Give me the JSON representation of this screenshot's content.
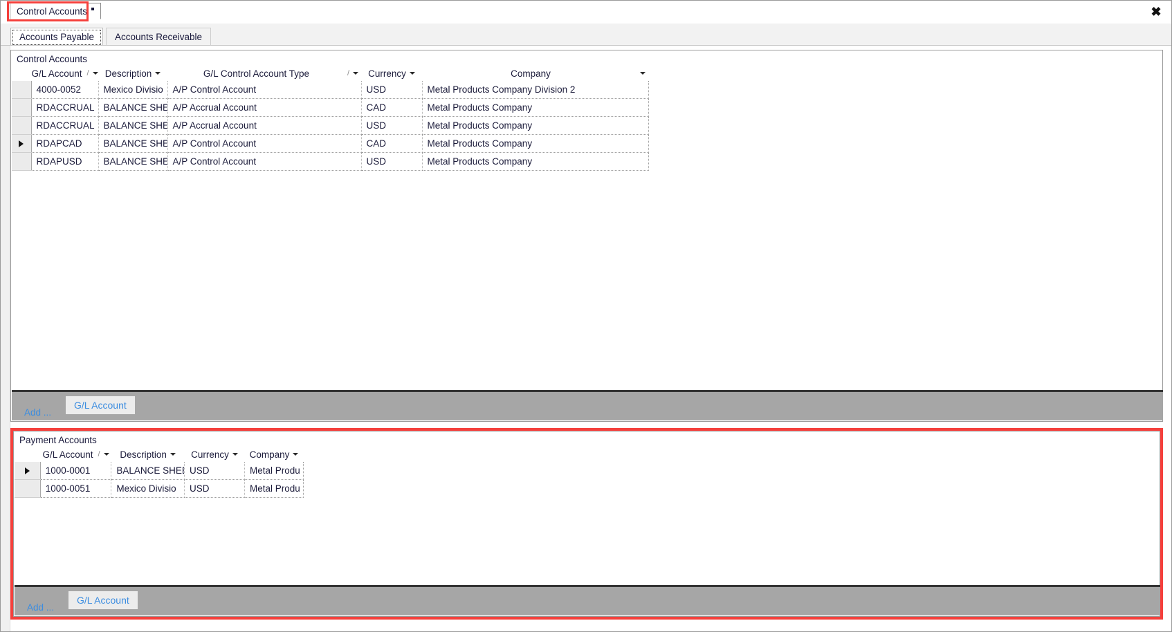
{
  "window": {
    "tab_label": "Control Accounts",
    "close_icon": "close-icon"
  },
  "tabs": [
    {
      "label": "Accounts Payable",
      "selected": true
    },
    {
      "label": "Accounts Receivable",
      "selected": false
    }
  ],
  "control_accounts": {
    "title": "Control Accounts",
    "columns": [
      {
        "label": "G/L Account",
        "sort": "/",
        "caret": true,
        "align": "center"
      },
      {
        "label": "Description",
        "sort": "",
        "caret": true,
        "align": "center"
      },
      {
        "label": "G/L Control Account Type",
        "sort": "/",
        "caret": true,
        "align": "center"
      },
      {
        "label": "Currency",
        "sort": "",
        "caret": true,
        "align": "center"
      },
      {
        "label": "Company",
        "sort": "",
        "caret": true,
        "align": "center"
      }
    ],
    "rows": [
      {
        "indicator": false,
        "gl_account": "4000-0052",
        "description": "Mexico Divisio",
        "account_type": "A/P Control Account",
        "currency": "USD",
        "company": "Metal Products Company Division 2"
      },
      {
        "indicator": false,
        "gl_account": "RDACCRUAL",
        "description": "BALANCE SHEE",
        "account_type": "A/P Accrual Account",
        "currency": "CAD",
        "company": "Metal Products Company"
      },
      {
        "indicator": false,
        "gl_account": "RDACCRUAL",
        "description": "BALANCE SHEE",
        "account_type": "A/P Accrual Account",
        "currency": "USD",
        "company": "Metal Products Company"
      },
      {
        "indicator": true,
        "gl_account": "RDAPCAD",
        "description": "BALANCE SHEE",
        "account_type": "A/P Control Account",
        "currency": "CAD",
        "company": "Metal Products Company"
      },
      {
        "indicator": false,
        "gl_account": "RDAPUSD",
        "description": "BALANCE SHEE",
        "account_type": "A/P Control Account",
        "currency": "USD",
        "company": "Metal Products Company"
      }
    ],
    "toolbar": {
      "add_label": "Add ...",
      "button_label": "G/L Account"
    }
  },
  "payment_accounts": {
    "title": "Payment Accounts",
    "columns": [
      {
        "label": "G/L Account",
        "sort": "/",
        "caret": true
      },
      {
        "label": "Description",
        "sort": "",
        "caret": true
      },
      {
        "label": "Currency",
        "sort": "",
        "caret": true
      },
      {
        "label": "Company",
        "sort": "",
        "caret": true
      }
    ],
    "rows": [
      {
        "indicator": true,
        "gl_account": "1000-0001",
        "description": "BALANCE SHEE",
        "currency": "USD",
        "company": "Metal Produ"
      },
      {
        "indicator": false,
        "gl_account": "1000-0051",
        "description": "Mexico Divisio",
        "currency": "USD",
        "company": "Metal Produ"
      }
    ],
    "toolbar": {
      "add_label": "Add ...",
      "button_label": "G/L Account"
    }
  },
  "colors": {
    "annotation": "#f5403c",
    "link": "#3c8de0",
    "command_bar": "#a6a6a6",
    "text": "#1b1b3a"
  }
}
